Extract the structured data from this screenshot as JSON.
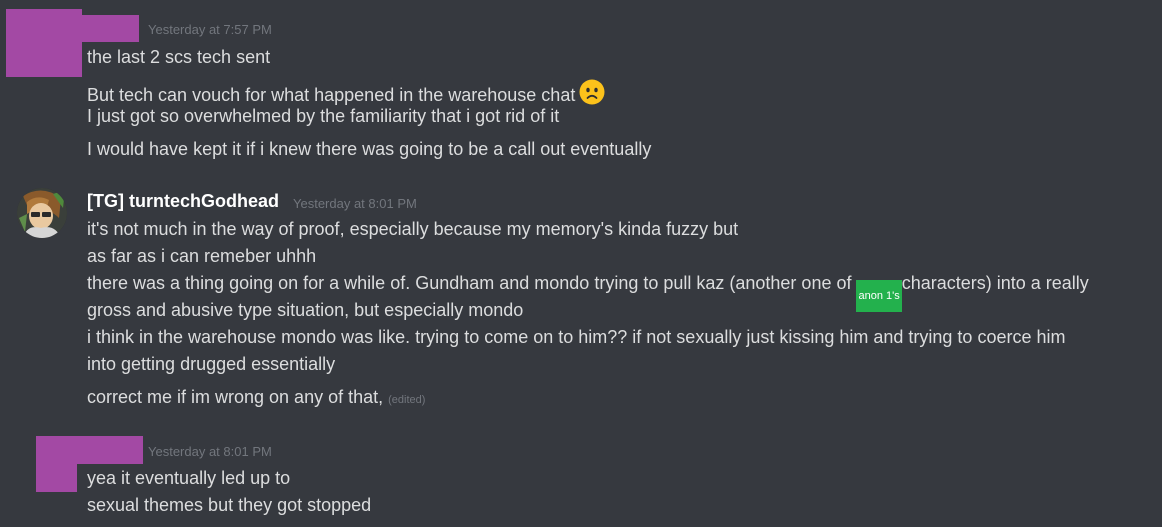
{
  "colors": {
    "background": "#36393f",
    "redaction": "#a349a4",
    "inline_highlight": "#23b14d"
  },
  "messages": [
    {
      "timestamp": "Yesterday at 7:57 PM",
      "lines": [
        "the last 2 scs tech sent",
        "But tech can vouch for what happened in the warehouse chat",
        "I just got so overwhelmed by the familiarity that i got rid of it",
        "I would have kept it if i knew there was going to be a call out eventually"
      ],
      "emoji": "frowning-face-icon"
    },
    {
      "username": "[TG] turntechGodhead",
      "timestamp": "Yesterday at 8:01 PM",
      "lines": [
        "it's not much in the way of proof, especially because my memory's kinda fuzzy but",
        "as far as i can remeber uhhh",
        "gross and abusive type situation, but especially mondo",
        "i think in the warehouse mondo was like. trying to come on to him?? if not sexually just kissing him and trying to coerce him",
        "into getting drugged essentially",
        "correct me if im wrong on any of that,"
      ],
      "line3_before": "there was a thing going on for a while of. Gundham and mondo trying to pull kaz (another one of ",
      "inline_label": "anon 1's",
      "line3_after": "characters) into a really",
      "edited": "(edited)"
    },
    {
      "timestamp": "Yesterday at 8:01 PM",
      "lines": [
        "yea it eventually led up to",
        "sexual themes but they got stopped"
      ]
    }
  ]
}
